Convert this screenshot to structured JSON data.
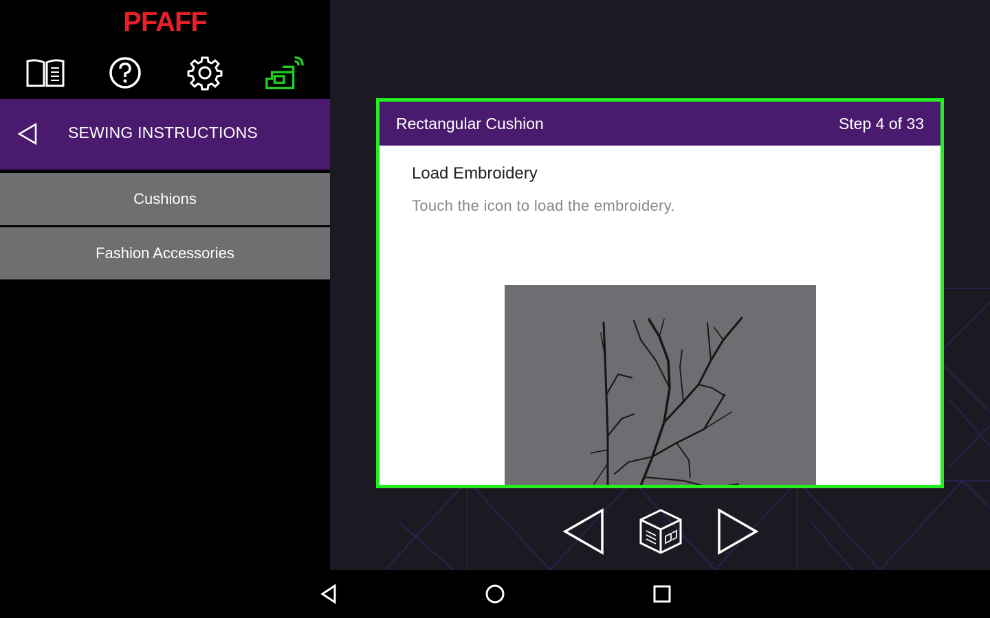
{
  "app": {
    "brand": "PFAFF",
    "brand_color": "#e8202a",
    "accent_color": "#4a1a6e",
    "highlight_color": "#22ee22"
  },
  "toolbar": {
    "icons": [
      "manual-book-icon",
      "help-icon",
      "settings-gear-icon",
      "sewing-machine-wifi-icon"
    ]
  },
  "sidebar": {
    "header": {
      "title": "SEWING INSTRUCTIONS",
      "back_icon": "back-arrow-icon"
    },
    "items": [
      {
        "label": "Cushions"
      },
      {
        "label": "Fashion Accessories"
      }
    ]
  },
  "instruction_card": {
    "project_title": "Rectangular Cushion",
    "step_label": "Step 4 of 33",
    "step_title": "Load Embroidery",
    "step_text": "Touch the icon to load the embroidery.",
    "image": "branch-embroidery-design"
  },
  "controls": {
    "previous_icon": "previous-step-icon",
    "load_icon": "load-embroidery-cube-icon",
    "next_icon": "next-step-icon"
  },
  "system_nav": [
    "android-back-icon",
    "android-home-icon",
    "android-recents-icon"
  ]
}
